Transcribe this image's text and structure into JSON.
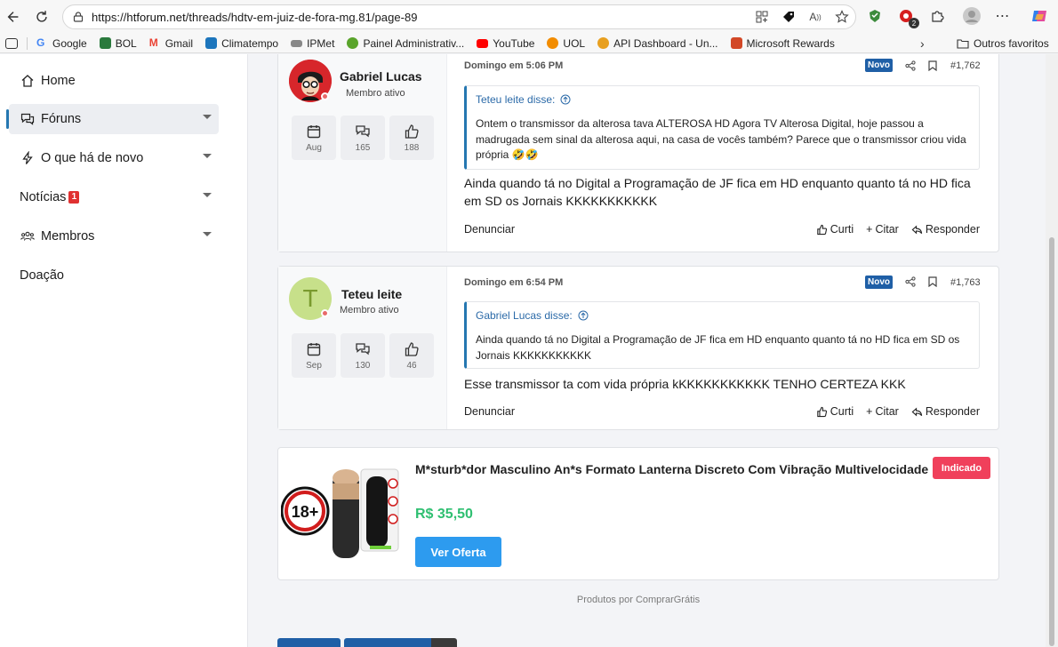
{
  "browser": {
    "url_prefix": "https://",
    "url_host": "htforum.net",
    "url_path": "/threads/hdtv-em-juiz-de-fora-mg.81/page-89",
    "profile_badge": "2",
    "bookmarks": [
      {
        "label": "Google",
        "icon": "google-icon",
        "color": "#4285f4"
      },
      {
        "label": "BOL",
        "icon": "bol-icon",
        "color": "#2a7a3d"
      },
      {
        "label": "Gmail",
        "icon": "gmail-icon",
        "color": "#ea4335"
      },
      {
        "label": "Climatempo",
        "icon": "climatempo-icon",
        "color": "#1c75bc"
      },
      {
        "label": "IPMet",
        "icon": "ipmet-icon",
        "color": "#555555"
      },
      {
        "label": "Painel Administrativ...",
        "icon": "painel-icon",
        "color": "#5aa42b"
      },
      {
        "label": "YouTube",
        "icon": "youtube-icon",
        "color": "#ff0000"
      },
      {
        "label": "UOL",
        "icon": "uol-icon",
        "color": "#f28c00"
      },
      {
        "label": "API Dashboard - Un...",
        "icon": "api-icon",
        "color": "#e8a020"
      },
      {
        "label": "Microsoft Rewards",
        "icon": "rewards-icon",
        "color": "#d24726"
      }
    ],
    "other_favorites": "Outros favoritos"
  },
  "sidebar": {
    "items": [
      {
        "label": "Home",
        "icon": "home-icon"
      },
      {
        "label": "Fóruns",
        "icon": "forums-icon"
      },
      {
        "label": "O que há de novo",
        "icon": "bolt-icon"
      },
      {
        "label": "Notícias",
        "icon": "",
        "badge": "1"
      },
      {
        "label": "Membros",
        "icon": "members-icon"
      },
      {
        "label": "Doação",
        "icon": ""
      }
    ]
  },
  "posts": [
    {
      "username": "Gabriel Lucas",
      "user_title": "Membro ativo",
      "stats": [
        "Aug",
        "165",
        "188"
      ],
      "date": "Domingo em 5:06 PM",
      "new_label": "Novo",
      "number": "#1,762",
      "quote_author": "Teteu leite disse:",
      "quote_text": "Ontem o transmissor da alterosa tava ALTEROSA HD Agora TV Alterosa Digital, hoje passou a madrugada sem sinal da alterosa aqui, na casa de vocês também? Parece que o transmissor criou vida própria 🤣🤣",
      "text": "Ainda quando tá no Digital a Programação de JF fica em HD enquanto quanto tá no HD fica em SD os Jornais KKKKKKKKKKK",
      "report": "Denunciar",
      "like": "Curti",
      "quote_btn": "Citar",
      "reply": "Responder"
    },
    {
      "username": "Teteu leite",
      "user_title": "Membro ativo",
      "avatar_letter": "T",
      "stats": [
        "Sep",
        "130",
        "46"
      ],
      "date": "Domingo em 6:54 PM",
      "new_label": "Novo",
      "number": "#1,763",
      "quote_author": "Gabriel Lucas disse:",
      "quote_text": "Ainda quando tá no Digital a Programação de JF fica em HD enquanto quanto tá no HD fica em SD os Jornais KKKKKKKKKKK",
      "text": "Esse transmissor ta com vida própria kKKKKKKKKKKK TENHO CERTEZA KKK",
      "report": "Denunciar",
      "like": "Curti",
      "quote_btn": "Citar",
      "reply": "Responder"
    }
  ],
  "ad": {
    "title": "M*sturb*dor Masculino An*s Formato Lanterna Discreto Com Vibração Multivelocidade",
    "price": "R$ 35,50",
    "button": "Ver Oferta",
    "badge": "Indicado",
    "age_label": "18+",
    "footer": "Produtos por ComprarGrátis"
  }
}
